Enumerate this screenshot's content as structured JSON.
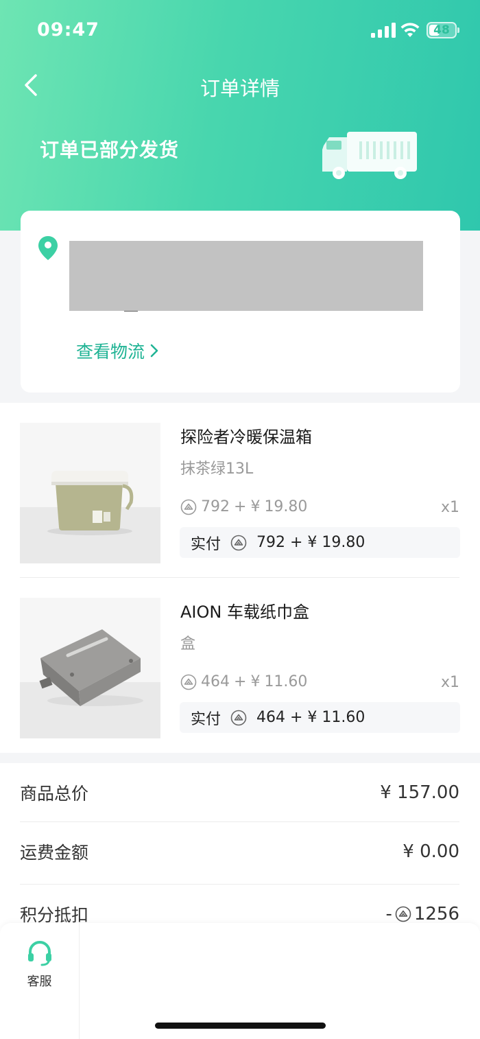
{
  "status_bar": {
    "time": "09:47",
    "battery": "48",
    "battery_level": 0.48
  },
  "nav": {
    "title": "订单详情"
  },
  "order": {
    "status": "订单已部分发货"
  },
  "address": {
    "view_logistics": "查看物流"
  },
  "items": [
    {
      "name": "探险者冷暖保温箱",
      "spec": "抹茶绿13L",
      "points": "792",
      "plus": "+",
      "currency": "¥",
      "price": "19.80",
      "qty": "x1",
      "paid_label": "实付",
      "paid_amount": "792 + ¥ 19.80"
    },
    {
      "name": "AION 车载纸巾盒",
      "spec": "盒",
      "points": "464",
      "plus": "+",
      "currency": "¥",
      "price": "11.60",
      "qty": "x1",
      "paid_label": "实付",
      "paid_amount": "464 + ¥ 11.60"
    }
  ],
  "summary": {
    "total_label": "商品总价",
    "total_value": "¥ 157.00",
    "shipping_label": "运费金额",
    "shipping_value": "¥ 0.00",
    "points_label": "积分抵扣",
    "points_prefix": "-",
    "points_value": "1256"
  },
  "bottom": {
    "service_label": "客服"
  },
  "colors": {
    "accent": "#1fb394",
    "hero_start": "#6ee5b3",
    "hero_end": "#2fc7ad"
  }
}
